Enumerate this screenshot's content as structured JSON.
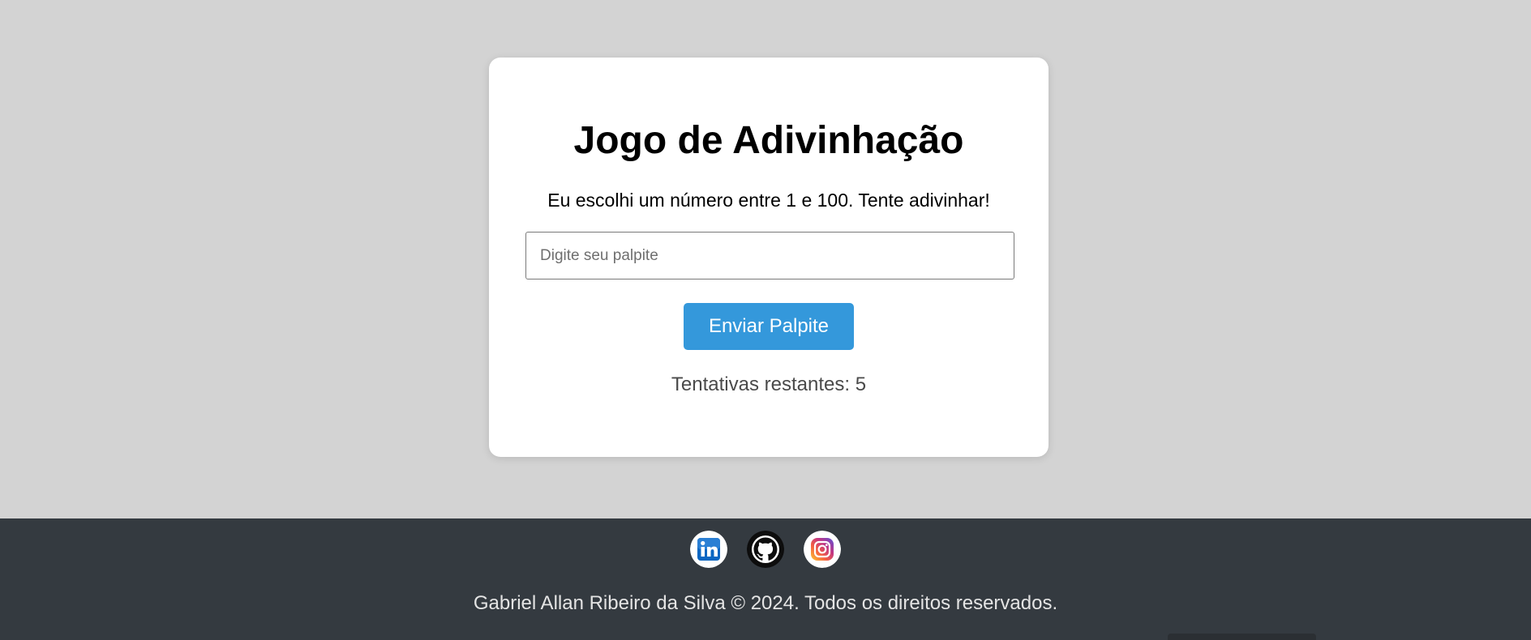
{
  "game": {
    "title": "Jogo de Adivinhação",
    "instructions": "Eu escolhi um número entre 1 e 100. Tente adivinhar!",
    "input_placeholder": "Digite seu palpite",
    "input_value": "",
    "submit_label": "Enviar Palpite",
    "attempts_text": "Tentativas restantes: 5"
  },
  "footer": {
    "social": [
      {
        "name": "LinkedIn",
        "icon": "linkedin-icon"
      },
      {
        "name": "GitHub",
        "icon": "github-icon"
      },
      {
        "name": "Instagram",
        "icon": "instagram-icon"
      }
    ],
    "copyright": "Gabriel Allan Ribeiro da Silva © 2024. Todos os direitos reservados."
  },
  "colors": {
    "page_background": "#d3d3d3",
    "card_background": "#ffffff",
    "button": "#3498db",
    "footer_background": "#343a40"
  }
}
